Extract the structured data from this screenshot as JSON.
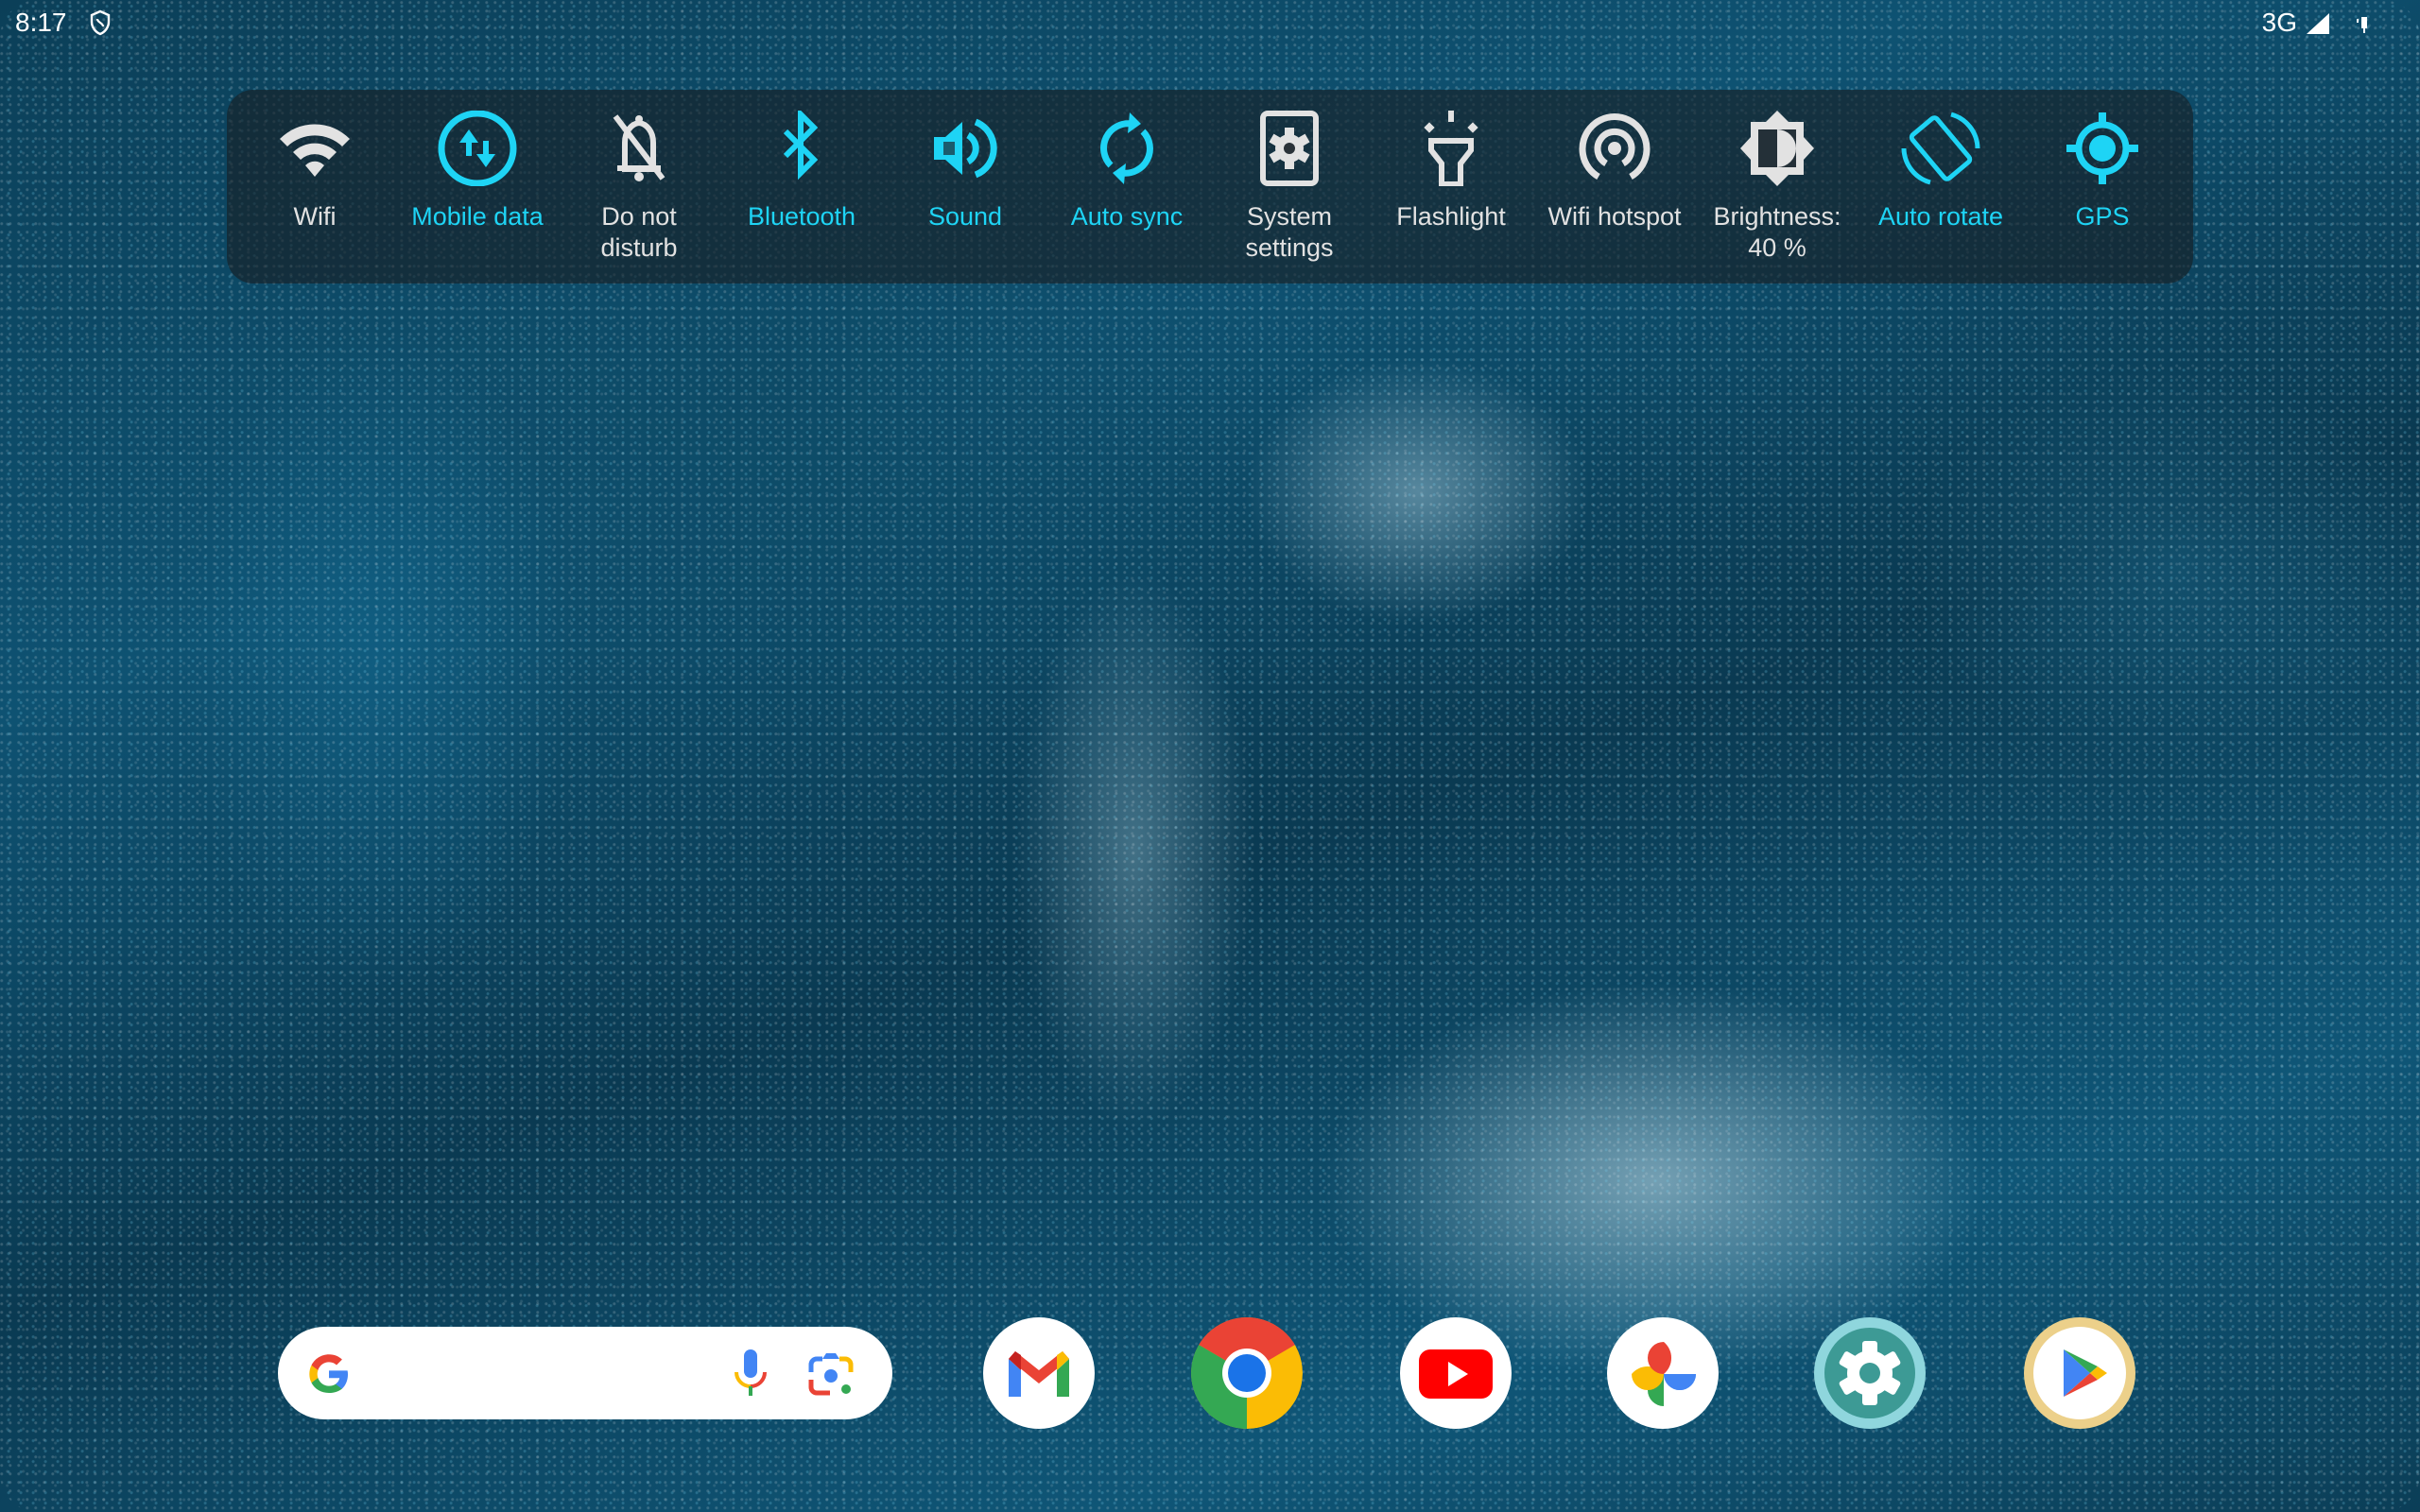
{
  "status_bar": {
    "time": "8:17",
    "vpn_icon": "shield-vpn-icon",
    "network_type": "3G",
    "signal_icon": "cell-signal-icon",
    "battery_icon": "battery-icon"
  },
  "quick_settings": {
    "accent_color": "#1ed4f5",
    "inactive_color": "#e2e2e2",
    "tiles": [
      {
        "label": "Wifi",
        "icon": "wifi-icon",
        "active": false
      },
      {
        "label": "Mobile data",
        "icon": "mobile-data-icon",
        "active": true
      },
      {
        "label": "Do not disturb",
        "icon": "bell-off-icon",
        "active": false
      },
      {
        "label": "Bluetooth",
        "icon": "bluetooth-icon",
        "active": true
      },
      {
        "label": "Sound",
        "icon": "speaker-icon",
        "active": true
      },
      {
        "label": "Auto sync",
        "icon": "sync-icon",
        "active": true
      },
      {
        "label": "System settings",
        "icon": "settings-gear-box-icon",
        "active": false
      },
      {
        "label": "Flashlight",
        "icon": "flashlight-icon",
        "active": false
      },
      {
        "label": "Wifi hotspot",
        "icon": "hotspot-icon",
        "active": false
      },
      {
        "label": "Brightness: 40 %",
        "icon": "brightness-icon",
        "active": false
      },
      {
        "label": "Auto rotate",
        "icon": "auto-rotate-icon",
        "active": true
      },
      {
        "label": "GPS",
        "icon": "gps-icon",
        "active": true
      }
    ]
  },
  "search_bar": {
    "placeholder": "",
    "logo_icon": "google-g-icon",
    "voice_icon": "microphone-icon",
    "lens_icon": "google-lens-icon"
  },
  "dock": {
    "apps": [
      {
        "name": "Gmail",
        "icon": "gmail-icon"
      },
      {
        "name": "Chrome",
        "icon": "chrome-icon"
      },
      {
        "name": "YouTube",
        "icon": "youtube-icon"
      },
      {
        "name": "Photos",
        "icon": "google-photos-icon"
      },
      {
        "name": "Settings",
        "icon": "settings-icon"
      },
      {
        "name": "Play Store",
        "icon": "play-store-icon"
      }
    ]
  }
}
